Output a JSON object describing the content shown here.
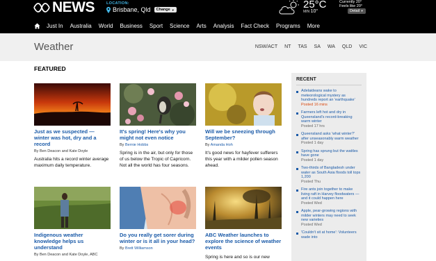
{
  "header": {
    "logo_text": "NEWS",
    "location_label": "LOCATION:",
    "location_city": "Brisbane, Qld",
    "change_label": "Change",
    "temperature": "25°C",
    "min_label": "MIN",
    "min_value": "10°",
    "currently_label": "Currently",
    "currently_value": "20°",
    "feels_like_label": "Feels like",
    "feels_like_value": "20°",
    "detail_label": "Detail"
  },
  "nav": {
    "items": [
      "Just In",
      "Australia",
      "World",
      "Business",
      "Sport",
      "Science",
      "Arts",
      "Analysis",
      "Fact Check",
      "Programs",
      "More"
    ]
  },
  "section": {
    "title": "Weather",
    "states": [
      "NSW/ACT",
      "NT",
      "TAS",
      "SA",
      "WA",
      "QLD",
      "VIC"
    ]
  },
  "featured": {
    "heading": "FEATURED",
    "cards": [
      {
        "title": "Just as we suspected — winter was hot, dry and a record",
        "by": "By",
        "author": "Ben Deacon and Kate Doyle",
        "summary": "Australia hits a record winter average maximum daily temperature."
      },
      {
        "title": "It's spring! Here's why you might not even notice",
        "by": "By",
        "author": "Bernie Hobbs",
        "summary": "Spring is in the air, but only for those of us below the Tropic of Capricorn. Not all the world has four seasons."
      },
      {
        "title": "Will we be sneezing through September?",
        "by": "By",
        "author": "Amanda Hoh",
        "summary": "It's good news for hayfever sufferers this year with a milder pollen season ahead."
      },
      {
        "title": "Indigenous weather knowledge helps us understand",
        "by": "By",
        "author": "Ben Deacon and Kate Doyle, ABC",
        "summary": ""
      },
      {
        "title": "Do you really get sorer during winter or is it all in your head?",
        "by": "By",
        "author": "Brett Williamson",
        "summary": ""
      },
      {
        "title": "ABC Weather launches to explore the science of weather events",
        "by": "",
        "author": "",
        "summary": "Spring is here and so is our new"
      }
    ]
  },
  "recent": {
    "heading": "RECENT",
    "items": [
      {
        "title": "Adelaideans wake to meteorological mystery as hundreds report an 'earthquake'",
        "time": "Posted 16 mins"
      },
      {
        "title": "Farmers left hot and dry in Queensland's record-breaking warm winter",
        "time": "Posted 17 hrs"
      },
      {
        "title": "Queensland asks 'what winter?' after unseasonably warm weather",
        "time": "Posted 1 day"
      },
      {
        "title": "Spring has sprung but the wattles have gone",
        "time": "Posted 1 day"
      },
      {
        "title": "Two-thirds of Bangladesh under water as South Asia floods toll tops 1,200",
        "time": "Posted Thu"
      },
      {
        "title": "Fire ants join together to make living raft in Harvey floodwaters — and it could happen here",
        "time": "Posted Wed"
      },
      {
        "title": "Apple, pear-growing regions with milder winters may need to seek new varieties",
        "time": "Posted Wed"
      },
      {
        "title": "'Couldn't sit at home': Volunteers wade into",
        "time": ""
      }
    ]
  },
  "colors": {
    "link_blue": "#1a5aa8",
    "accent_cyan": "#43b6e6",
    "fresh_time": "#d9470e"
  }
}
